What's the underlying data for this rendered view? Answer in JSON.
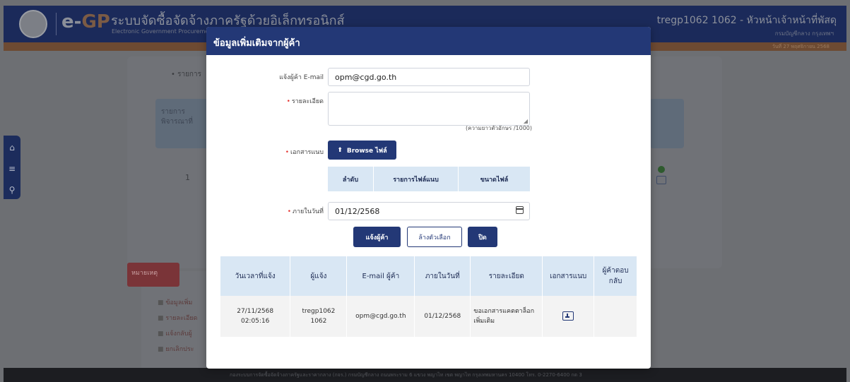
{
  "header": {
    "system_logo_text": "e-GP",
    "system_name": "ระบบจัดซื้อจัดจ้างภาครัฐด้วยอิเล็กทรอนิกส์",
    "system_subname": "Electronic Government Procurement",
    "user_name": "tregp1062 1062 - หัวหน้าเจ้าหน้าที่พัสดุ",
    "user_department": "กรมบัญชีกลาง กรุงเทพฯ",
    "date_text": "วันที่ 27 พฤศจิกายน 2568"
  },
  "background": {
    "list_item": "• รายการ",
    "table_header": "รายการพิจารณาที่",
    "row_number": "1",
    "side_tab": "หมายเหตุ",
    "menu_items": [
      "ข้อมูลเพิ่ม",
      "รายละเอียด",
      "แจ้งกลับผู้",
      "ยกเลิกประ"
    ],
    "footer_text": "กองระบบการจัดซื้อจัดจ้างภาครัฐและราคากลาง (กจร.) กรมบัญชีกลาง ถนนพระราม 6 แขวง พญาไท เขต พญาไท กรุงเทพมหานคร 10400 โทร. 0-2270-6400 กด 3"
  },
  "modal": {
    "title": "ข้อมูลเพิ่มเติมจากผู้ค้า",
    "email_label": "แจ้งผู้ค้า E-mail",
    "email_value": "opm@cgd.go.th",
    "detail_label": "รายละเอียด",
    "detail_hint": "(ความยาวตัวอักษร /1000)",
    "attach_label": "เอกสารแนบ",
    "browse_label": "Browse ไฟล์",
    "file_table_headers": [
      "ลำดับ",
      "รายการไฟล์แนบ",
      "ขนาดไฟล์"
    ],
    "within_label": "ภายในวันที่",
    "within_value": "01/12/2568",
    "notify_label": "แจ้งผู้ค้า",
    "clear_label": "ล้างตัวเลือก",
    "close_label": "ปิด"
  },
  "history": {
    "headers": [
      "วันเวลาที่แจ้ง",
      "ผู้แจ้ง",
      "E-mail ผู้ค้า",
      "ภายในวันที่",
      "รายละเอียด",
      "เอกสารแนบ",
      "ผู้ค้าตอบกลับ"
    ],
    "rows": [
      {
        "datetime": "27/11/2568\n02:05:16",
        "informer": "tregp1062\n1062",
        "email": "opm@cgd.go.th",
        "within": "01/12/2568",
        "detail": "ขอเอกสารแคตตาล็อกเพิ่มเติม",
        "attachment_icon": "download-icon",
        "reply": ""
      }
    ]
  },
  "colors": {
    "primary": "#233876",
    "header_bg": "#d9e7f4",
    "required": "#e53935"
  }
}
